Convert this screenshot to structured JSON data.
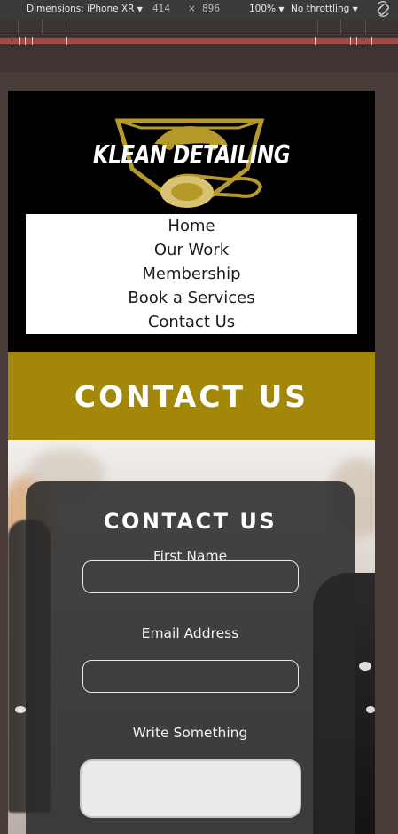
{
  "devtools": {
    "device": "Dimensions: iPhone XR",
    "width": "414",
    "times": "×",
    "height": "896",
    "zoom": "100%",
    "throttling": "No throttling",
    "dropdown_glyph": "▼"
  },
  "site": {
    "logo_text": "KLEAN DETAILING",
    "nav": [
      "Home",
      "Our Work",
      "Membership",
      "Book a Services",
      "Contact Us"
    ],
    "banner_title": "CONTACT US"
  },
  "form": {
    "title": "CONTACT US",
    "first_name_label": "First Name",
    "first_name_value": "",
    "email_label": "Email Address",
    "email_value": "",
    "message_label": "Write Something",
    "message_value": ""
  },
  "colors": {
    "banner": "#a28708",
    "logo_gold": "#b59a2a",
    "card": "#282828"
  }
}
